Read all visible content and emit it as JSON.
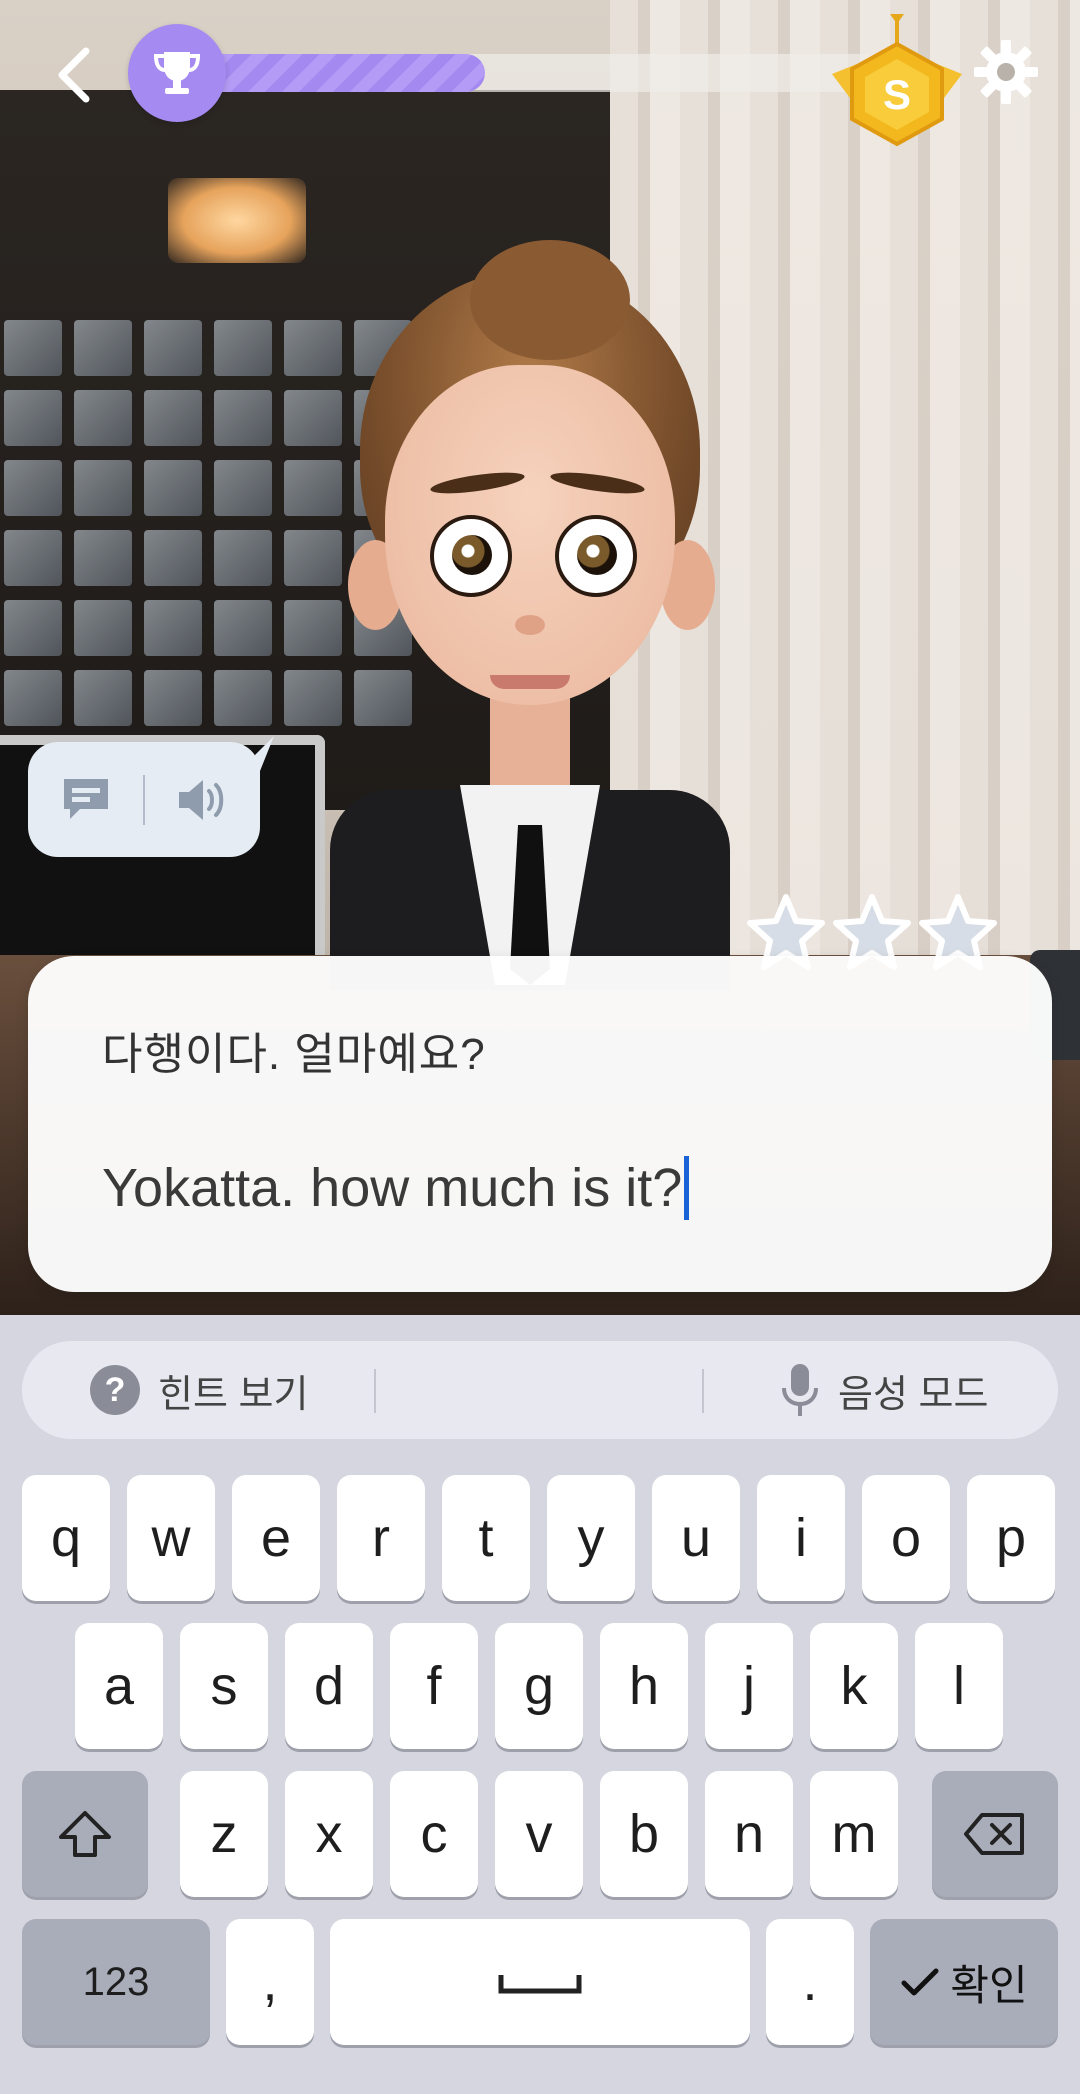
{
  "header": {
    "progress_percent": 43,
    "back_icon": "chevron-left-icon",
    "trophy_icon": "trophy-icon",
    "medal_icon": "s-medal-icon",
    "medal_letter": "S",
    "settings_icon": "gear-icon"
  },
  "speech_controls": {
    "subtitle_icon": "subtitle-icon",
    "audio_icon": "speaker-icon"
  },
  "rating": {
    "stars_total": 3,
    "stars_filled": 0
  },
  "dialogue": {
    "prompt": "다행이다. 얼마예요?",
    "answer": "Yokatta. how much is it?"
  },
  "keyboard": {
    "tools": {
      "hint_label": "힌트 보기",
      "voice_label": "음성 모드"
    },
    "row1": [
      "q",
      "w",
      "e",
      "r",
      "t",
      "y",
      "u",
      "i",
      "o",
      "p"
    ],
    "row2": [
      "a",
      "s",
      "d",
      "f",
      "g",
      "h",
      "j",
      "k",
      "l"
    ],
    "row3": [
      "z",
      "x",
      "c",
      "v",
      "b",
      "n",
      "m"
    ],
    "numbers_label": "123",
    "comma": ",",
    "period": ".",
    "confirm_label": "확인"
  },
  "colors": {
    "accent": "#a58af1",
    "cursor": "#1a63d6"
  }
}
